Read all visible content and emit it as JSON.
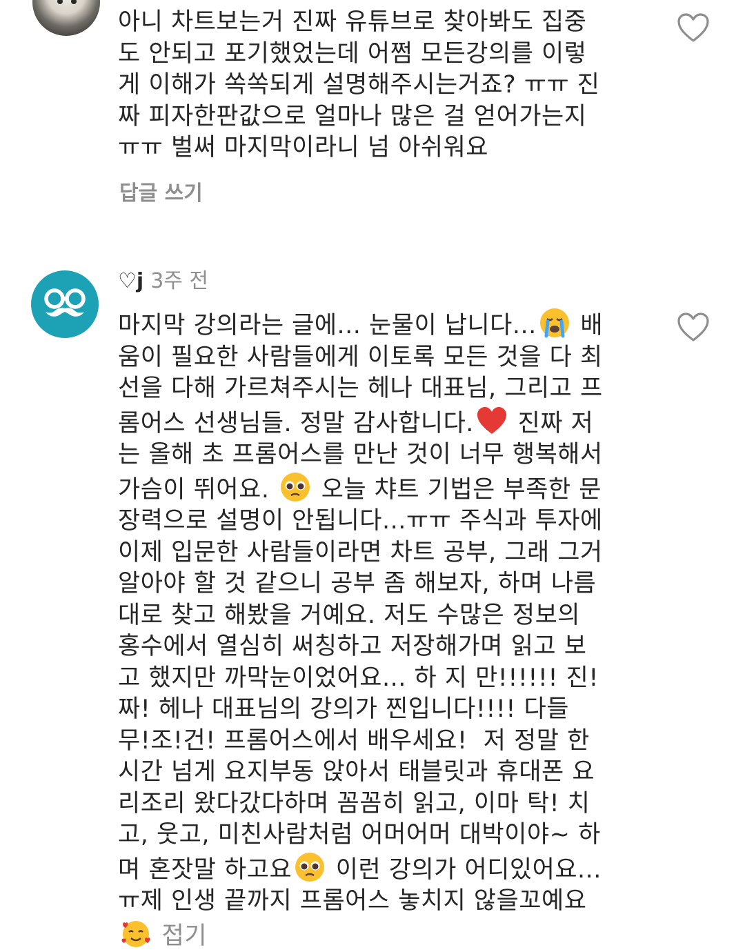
{
  "comments": [
    {
      "text": "아니 차트보는거 진짜 유튜브로 찾아봐도 집중도 안되고 포기했었는데 어쩜 모든강의를 이렇게 이해가 쏙쏙되게 설명해주시는거죠? ㅠㅠ 진짜 피자한판값으로 얼마나 많은 걸 얻어가는지 ㅠㅠ 벌써 마지막이라니 넘 아쉬워요",
      "reply_label": "답글 쓰기"
    },
    {
      "username": "♡j",
      "time": "3주 전",
      "part1": "마지막 강의라는 글에... 눈물이 납니다...",
      "part2": " 배움이 필요한 사람들에게 이토록 모든 것을 다 최선을 다해 가르쳐주시는 헤나 대표님, 그리고 프롬어스 선생님들. 정말 감사합니다.",
      "part3": " 진짜 저는 올해 초 프롬어스를 만난 것이 너무 행복해서 가슴이 뛰어요. ",
      "part4": " 오늘 챠트 기법은 부족한 문장력으로 설명이 안됩니다...ㅠㅠ 주식과 투자에 이제 입문한 사람들이라면 차트 공부, 그래 그거 알아야 할 것 같으니 공부 좀 해보자, 하며 나름대로 찾고 해봤을 거예요. 저도 수많은 정보의 홍수에서 열심히 써칭하고 저장해가며 읽고 보고 했지만 까막눈이었어요... 하 지 만!!!!!! 진!짜! 헤나 대표님의 강의가 찐입니다!!!! 다들 무!조!건! 프롬어스에서 배우세요!  저 정말 한시간 넘게 요지부동 앉아서 태블릿과 휴대폰 요리조리 왔다갔다하며 꼼꼼히 읽고, 이마 탁! 치고, 웃고, 미친사람처럼 어머어머 대박이야~ 하며 혼잣말 하고요",
      "part5": " 이런 강의가 어디있어요... ㅠ제 인생 끝까지 프롬어스 놓치지 않을꼬예요",
      "collapse_label": " 접기"
    }
  ],
  "colors": {
    "text": "#262626",
    "muted": "#8e8e8e",
    "avatar_teal": "#1da1b5"
  },
  "icons": [
    "heart-outline-icon",
    "glasses-mustache-avatar-icon",
    "crying-face-emoji",
    "red-heart-emoji",
    "pleading-face-emoji",
    "smiling-face-with-hearts-emoji"
  ]
}
